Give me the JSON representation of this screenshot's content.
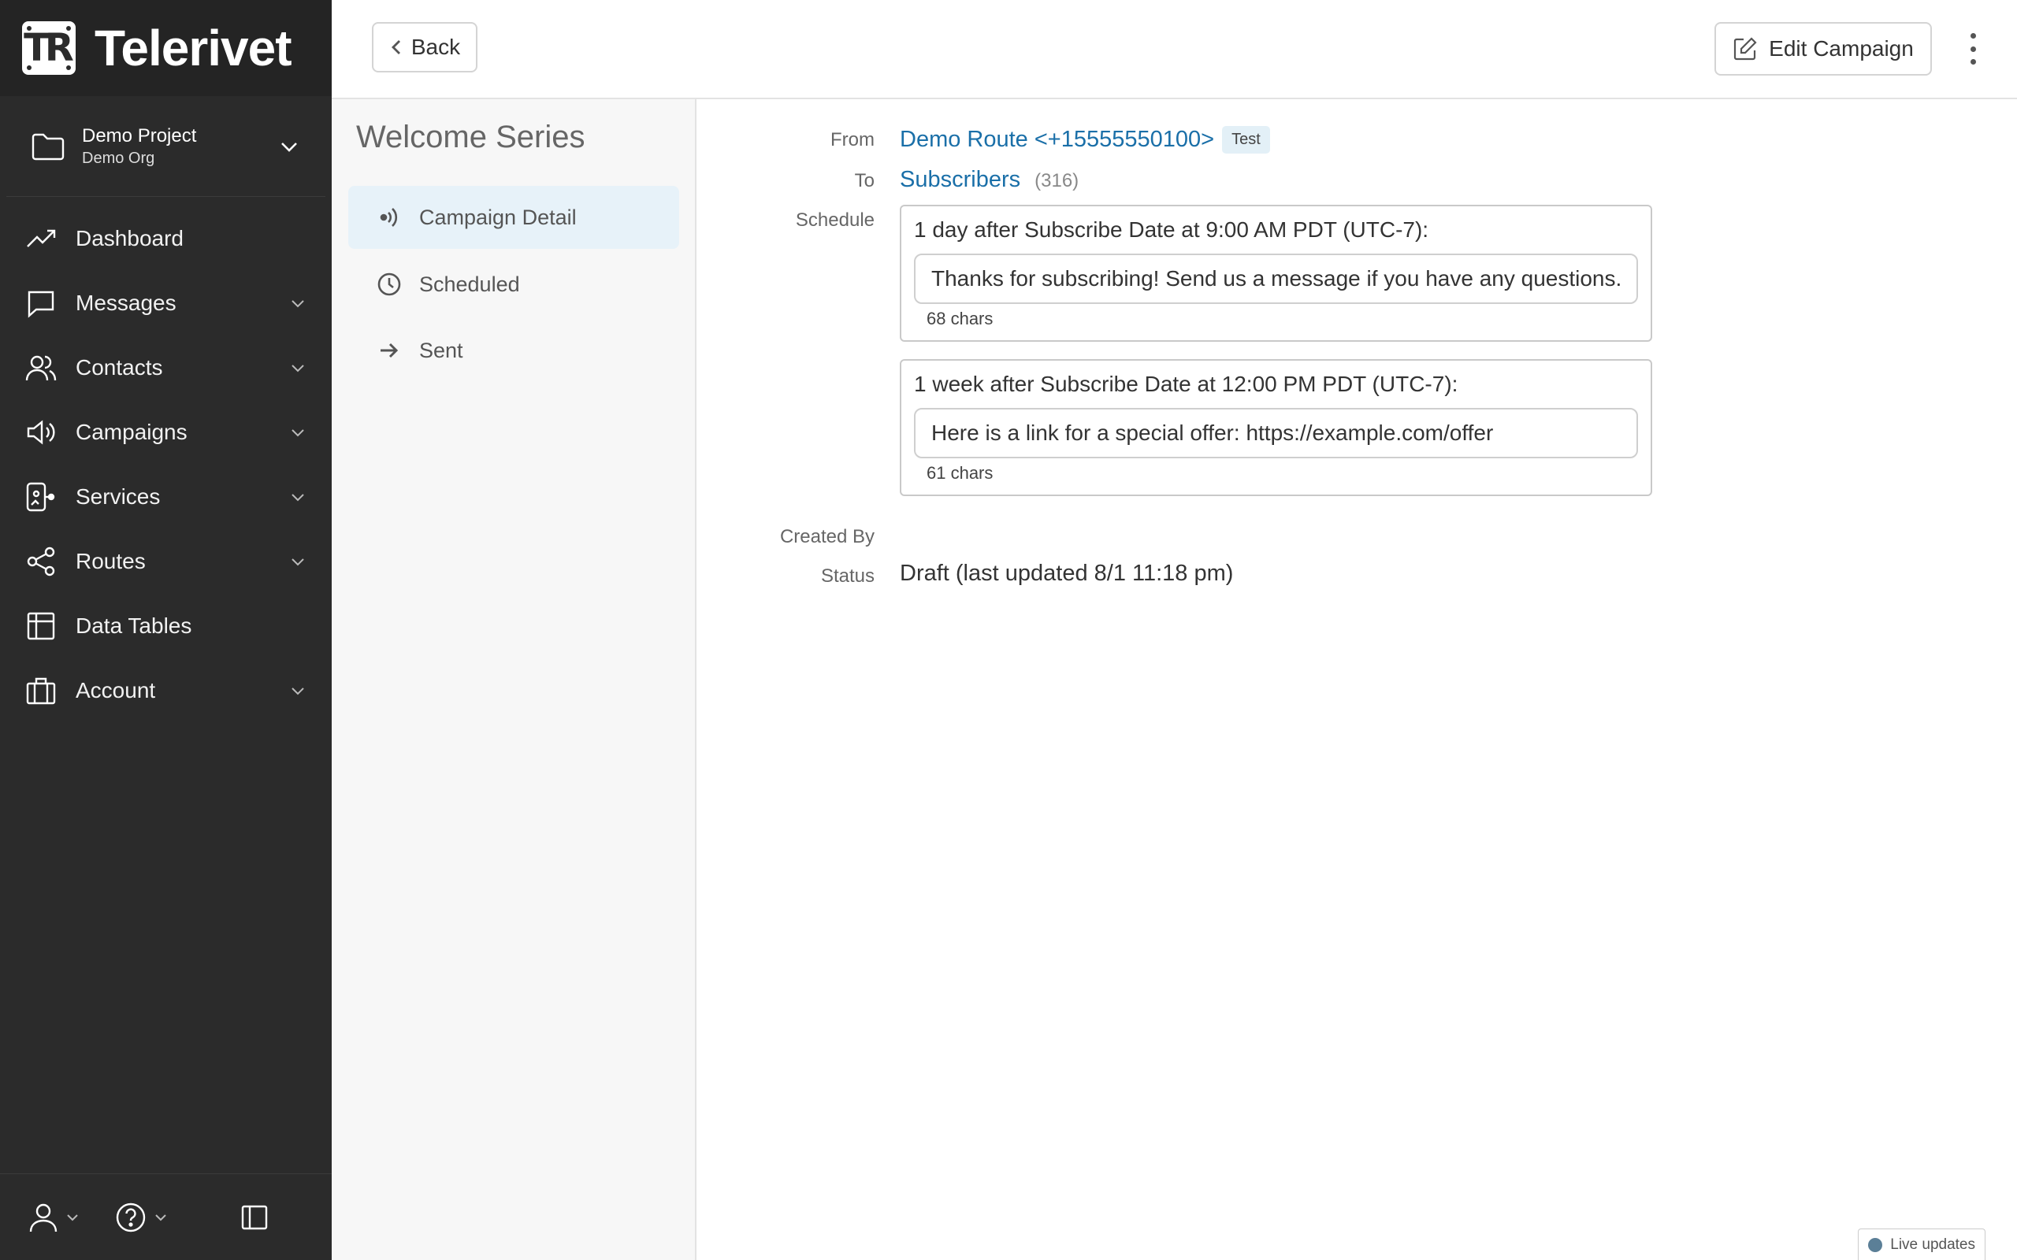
{
  "app": {
    "brand": "Telerivet",
    "brand_mark": "TR"
  },
  "project": {
    "name": "Demo Project",
    "org": "Demo Org"
  },
  "nav": {
    "items": [
      {
        "label": "Dashboard",
        "icon": "trending-up-icon",
        "has_chevron": false
      },
      {
        "label": "Messages",
        "icon": "message-icon",
        "has_chevron": true
      },
      {
        "label": "Contacts",
        "icon": "users-icon",
        "has_chevron": true
      },
      {
        "label": "Campaigns",
        "icon": "megaphone-icon",
        "has_chevron": true
      },
      {
        "label": "Services",
        "icon": "services-icon",
        "has_chevron": true
      },
      {
        "label": "Routes",
        "icon": "share-icon",
        "has_chevron": true
      },
      {
        "label": "Data Tables",
        "icon": "table-icon",
        "has_chevron": false
      },
      {
        "label": "Account",
        "icon": "briefcase-icon",
        "has_chevron": true
      }
    ]
  },
  "header": {
    "back_label": "Back",
    "edit_label": "Edit Campaign"
  },
  "subnav": {
    "title": "Welcome Series",
    "items": [
      {
        "label": "Campaign Detail",
        "icon": "broadcast-icon",
        "active": true
      },
      {
        "label": "Scheduled",
        "icon": "clock-icon",
        "active": false
      },
      {
        "label": "Sent",
        "icon": "arrow-right-icon",
        "active": false
      }
    ]
  },
  "detail": {
    "labels": {
      "from": "From",
      "to": "To",
      "schedule": "Schedule",
      "created_by": "Created By",
      "status": "Status"
    },
    "from": {
      "route": "Demo Route <+15555550100>",
      "tag": "Test"
    },
    "to": {
      "group": "Subscribers",
      "count": "(316)"
    },
    "schedule": [
      {
        "when": "1 day after Subscribe Date at 9:00 AM PDT (UTC-7):",
        "message": "Thanks for subscribing! Send us a message if you have any questions.",
        "chars": "68 chars"
      },
      {
        "when": "1 week after Subscribe Date at 12:00 PM PDT (UTC-7):",
        "message": "Here is a link for a special offer: https://example.com/offer",
        "chars": "61 chars"
      }
    ],
    "created_by": "",
    "status": "Draft (last updated 8/1 11:18 pm)"
  },
  "footer": {
    "live_updates": "Live updates"
  },
  "colors": {
    "sidebar_bg": "#2b2b2b",
    "link": "#1a6fa8",
    "active_subnav": "#e7f2f9"
  }
}
